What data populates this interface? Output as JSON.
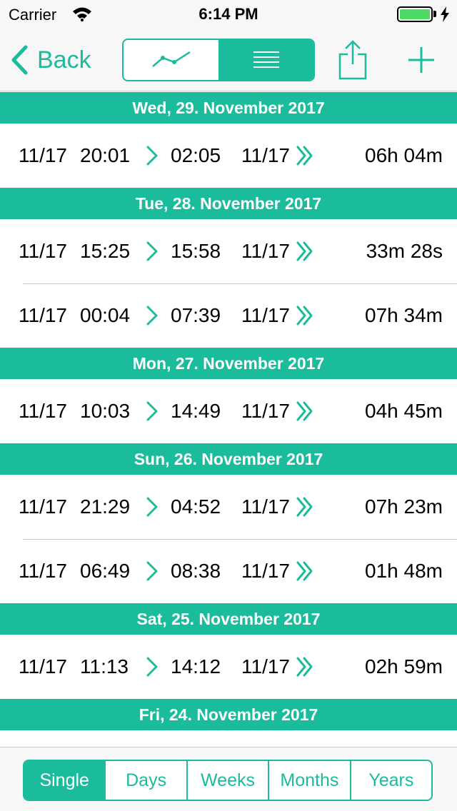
{
  "status_bar": {
    "carrier": "Carrier",
    "time": "6:14 PM"
  },
  "nav": {
    "back_label": "Back",
    "view_segments": [
      {
        "icon": "line-chart-icon",
        "active": false
      },
      {
        "icon": "list-icon",
        "active": true
      }
    ]
  },
  "colors": {
    "accent": "#1abc9c",
    "separator": "#c8c7cc",
    "battery": "#4cd964"
  },
  "sections": [
    {
      "title": "Wed, 29. November 2017",
      "rows": [
        {
          "start_date": "11/17",
          "start_time": "20:01",
          "end_time": "02:05",
          "end_date": "11/17",
          "duration": "06h 04m"
        }
      ]
    },
    {
      "title": "Tue, 28. November 2017",
      "rows": [
        {
          "start_date": "11/17",
          "start_time": "15:25",
          "end_time": "15:58",
          "end_date": "11/17",
          "duration": "33m 28s"
        },
        {
          "start_date": "11/17",
          "start_time": "00:04",
          "end_time": "07:39",
          "end_date": "11/17",
          "duration": "07h 34m"
        }
      ]
    },
    {
      "title": "Mon, 27. November 2017",
      "rows": [
        {
          "start_date": "11/17",
          "start_time": "10:03",
          "end_time": "14:49",
          "end_date": "11/17",
          "duration": "04h 45m"
        }
      ]
    },
    {
      "title": "Sun, 26. November 2017",
      "rows": [
        {
          "start_date": "11/17",
          "start_time": "21:29",
          "end_time": "04:52",
          "end_date": "11/17",
          "duration": "07h 23m"
        },
        {
          "start_date": "11/17",
          "start_time": "06:49",
          "end_time": "08:38",
          "end_date": "11/17",
          "duration": "01h 48m"
        }
      ]
    },
    {
      "title": "Sat, 25. November 2017",
      "rows": [
        {
          "start_date": "11/17",
          "start_time": "11:13",
          "end_time": "14:12",
          "end_date": "11/17",
          "duration": "02h 59m"
        }
      ]
    },
    {
      "title": "Fri, 24. November 2017",
      "rows": []
    }
  ],
  "period_tabs": [
    {
      "label": "Single",
      "active": true
    },
    {
      "label": "Days",
      "active": false
    },
    {
      "label": "Weeks",
      "active": false
    },
    {
      "label": "Months",
      "active": false
    },
    {
      "label": "Years",
      "active": false
    }
  ]
}
